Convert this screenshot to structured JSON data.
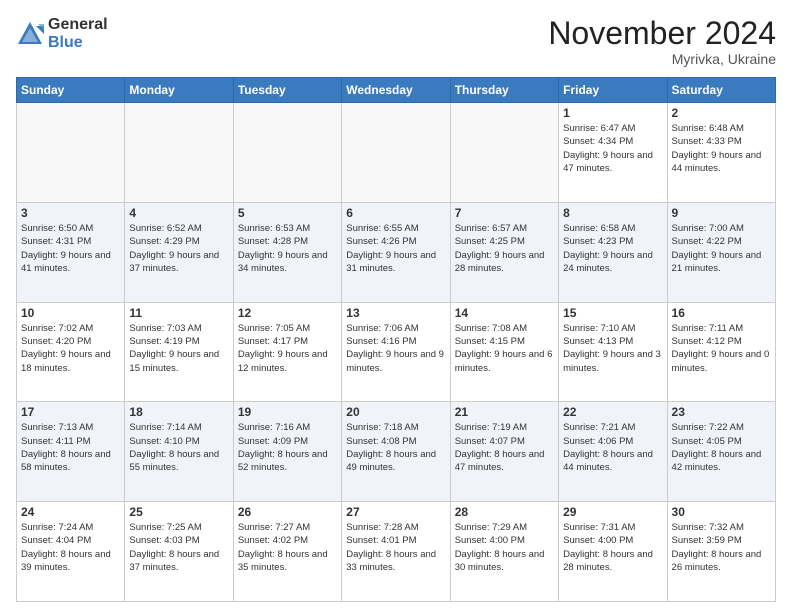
{
  "logo": {
    "general": "General",
    "blue": "Blue"
  },
  "title": "November 2024",
  "location": "Myrivka, Ukraine",
  "days_of_week": [
    "Sunday",
    "Monday",
    "Tuesday",
    "Wednesday",
    "Thursday",
    "Friday",
    "Saturday"
  ],
  "weeks": [
    [
      {
        "day": "",
        "info": ""
      },
      {
        "day": "",
        "info": ""
      },
      {
        "day": "",
        "info": ""
      },
      {
        "day": "",
        "info": ""
      },
      {
        "day": "",
        "info": ""
      },
      {
        "day": "1",
        "info": "Sunrise: 6:47 AM\nSunset: 4:34 PM\nDaylight: 9 hours and 47 minutes."
      },
      {
        "day": "2",
        "info": "Sunrise: 6:48 AM\nSunset: 4:33 PM\nDaylight: 9 hours and 44 minutes."
      }
    ],
    [
      {
        "day": "3",
        "info": "Sunrise: 6:50 AM\nSunset: 4:31 PM\nDaylight: 9 hours and 41 minutes."
      },
      {
        "day": "4",
        "info": "Sunrise: 6:52 AM\nSunset: 4:29 PM\nDaylight: 9 hours and 37 minutes."
      },
      {
        "day": "5",
        "info": "Sunrise: 6:53 AM\nSunset: 4:28 PM\nDaylight: 9 hours and 34 minutes."
      },
      {
        "day": "6",
        "info": "Sunrise: 6:55 AM\nSunset: 4:26 PM\nDaylight: 9 hours and 31 minutes."
      },
      {
        "day": "7",
        "info": "Sunrise: 6:57 AM\nSunset: 4:25 PM\nDaylight: 9 hours and 28 minutes."
      },
      {
        "day": "8",
        "info": "Sunrise: 6:58 AM\nSunset: 4:23 PM\nDaylight: 9 hours and 24 minutes."
      },
      {
        "day": "9",
        "info": "Sunrise: 7:00 AM\nSunset: 4:22 PM\nDaylight: 9 hours and 21 minutes."
      }
    ],
    [
      {
        "day": "10",
        "info": "Sunrise: 7:02 AM\nSunset: 4:20 PM\nDaylight: 9 hours and 18 minutes."
      },
      {
        "day": "11",
        "info": "Sunrise: 7:03 AM\nSunset: 4:19 PM\nDaylight: 9 hours and 15 minutes."
      },
      {
        "day": "12",
        "info": "Sunrise: 7:05 AM\nSunset: 4:17 PM\nDaylight: 9 hours and 12 minutes."
      },
      {
        "day": "13",
        "info": "Sunrise: 7:06 AM\nSunset: 4:16 PM\nDaylight: 9 hours and 9 minutes."
      },
      {
        "day": "14",
        "info": "Sunrise: 7:08 AM\nSunset: 4:15 PM\nDaylight: 9 hours and 6 minutes."
      },
      {
        "day": "15",
        "info": "Sunrise: 7:10 AM\nSunset: 4:13 PM\nDaylight: 9 hours and 3 minutes."
      },
      {
        "day": "16",
        "info": "Sunrise: 7:11 AM\nSunset: 4:12 PM\nDaylight: 9 hours and 0 minutes."
      }
    ],
    [
      {
        "day": "17",
        "info": "Sunrise: 7:13 AM\nSunset: 4:11 PM\nDaylight: 8 hours and 58 minutes."
      },
      {
        "day": "18",
        "info": "Sunrise: 7:14 AM\nSunset: 4:10 PM\nDaylight: 8 hours and 55 minutes."
      },
      {
        "day": "19",
        "info": "Sunrise: 7:16 AM\nSunset: 4:09 PM\nDaylight: 8 hours and 52 minutes."
      },
      {
        "day": "20",
        "info": "Sunrise: 7:18 AM\nSunset: 4:08 PM\nDaylight: 8 hours and 49 minutes."
      },
      {
        "day": "21",
        "info": "Sunrise: 7:19 AM\nSunset: 4:07 PM\nDaylight: 8 hours and 47 minutes."
      },
      {
        "day": "22",
        "info": "Sunrise: 7:21 AM\nSunset: 4:06 PM\nDaylight: 8 hours and 44 minutes."
      },
      {
        "day": "23",
        "info": "Sunrise: 7:22 AM\nSunset: 4:05 PM\nDaylight: 8 hours and 42 minutes."
      }
    ],
    [
      {
        "day": "24",
        "info": "Sunrise: 7:24 AM\nSunset: 4:04 PM\nDaylight: 8 hours and 39 minutes."
      },
      {
        "day": "25",
        "info": "Sunrise: 7:25 AM\nSunset: 4:03 PM\nDaylight: 8 hours and 37 minutes."
      },
      {
        "day": "26",
        "info": "Sunrise: 7:27 AM\nSunset: 4:02 PM\nDaylight: 8 hours and 35 minutes."
      },
      {
        "day": "27",
        "info": "Sunrise: 7:28 AM\nSunset: 4:01 PM\nDaylight: 8 hours and 33 minutes."
      },
      {
        "day": "28",
        "info": "Sunrise: 7:29 AM\nSunset: 4:00 PM\nDaylight: 8 hours and 30 minutes."
      },
      {
        "day": "29",
        "info": "Sunrise: 7:31 AM\nSunset: 4:00 PM\nDaylight: 8 hours and 28 minutes."
      },
      {
        "day": "30",
        "info": "Sunrise: 7:32 AM\nSunset: 3:59 PM\nDaylight: 8 hours and 26 minutes."
      }
    ]
  ]
}
